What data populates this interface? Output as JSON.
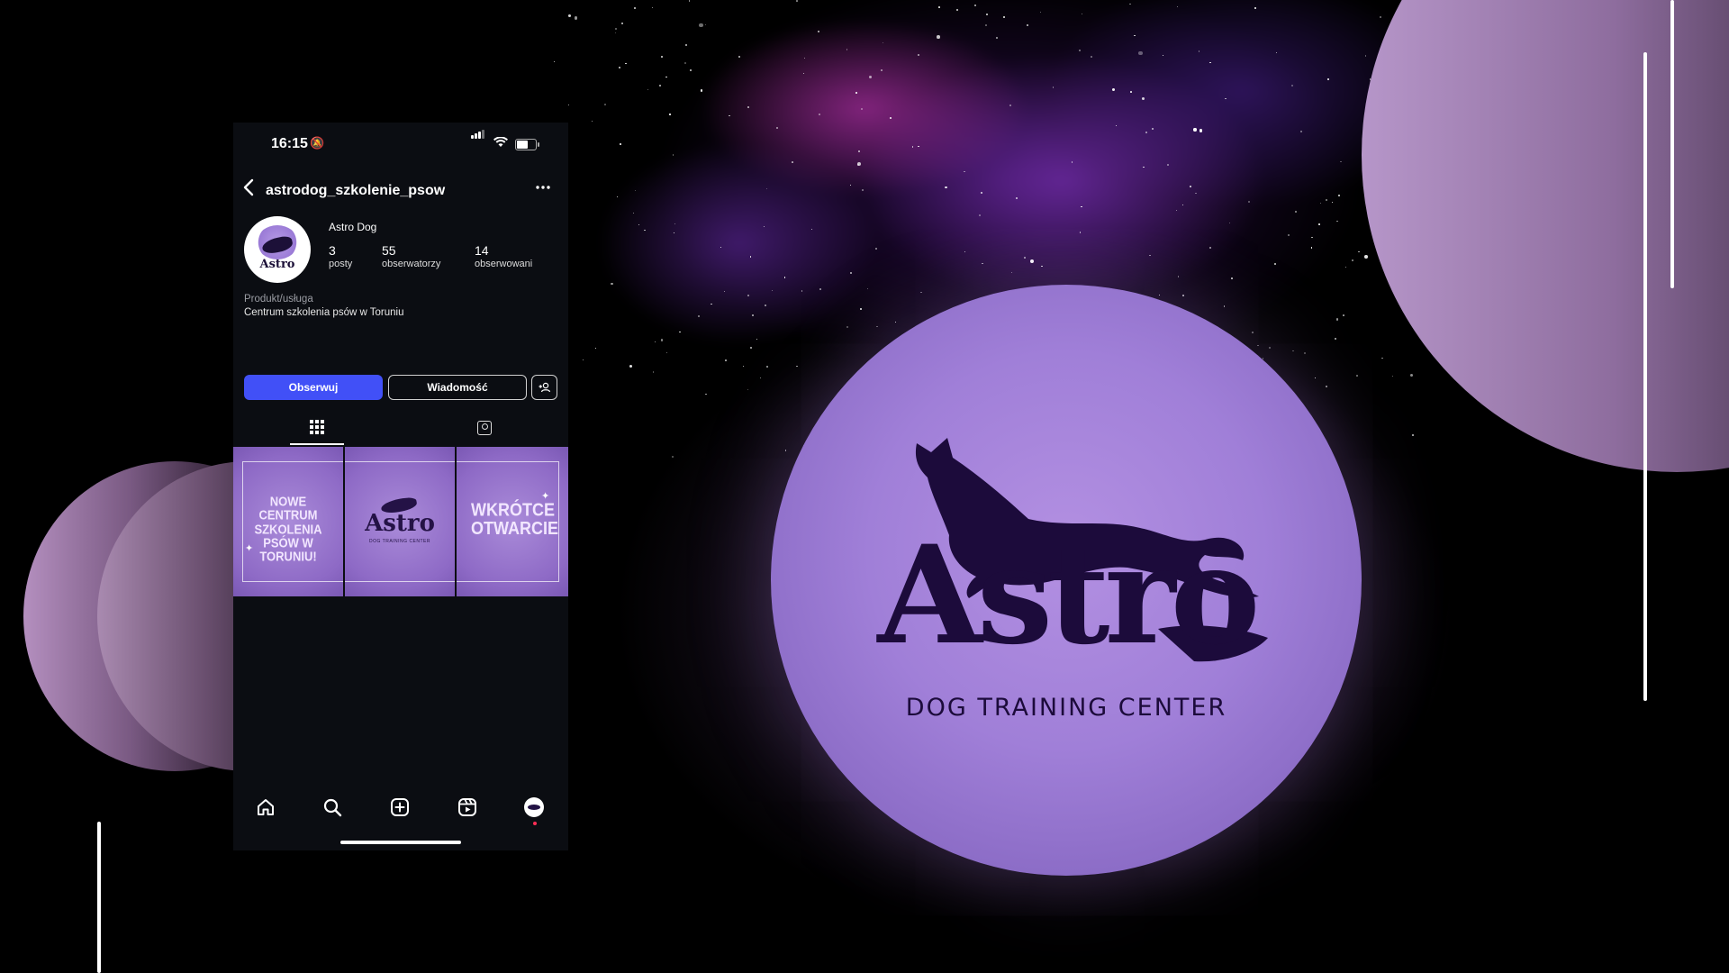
{
  "status_bar": {
    "time": "16:15"
  },
  "profile": {
    "username": "astrodog_szkolenie_psow",
    "display_name": "Astro Dog",
    "avatar_text": "Astro",
    "stats": [
      {
        "count": "3",
        "label": "posty"
      },
      {
        "count": "55",
        "label": "obserwatorzy"
      },
      {
        "count": "14",
        "label": "obserwowani"
      }
    ],
    "category": "Produkt/usługa",
    "bio": "Centrum szkolenia psów w Toruniu"
  },
  "actions": {
    "follow_label": "Obserwuj",
    "message_label": "Wiadomość",
    "follow_color": "#4150f7"
  },
  "posts": [
    {
      "text": "NOWE CENTRUM SZKOLENIA PSÓW W TORUNIU!"
    },
    {
      "logo_text": "Astro",
      "logo_sub": "DOG TRAINING CENTER"
    },
    {
      "text": "WKRÓTCE OTWARCIE"
    }
  ],
  "nav": {
    "items": [
      "home-icon",
      "search-icon",
      "create-icon",
      "reels-icon",
      "profile-icon"
    ]
  },
  "brand": {
    "logo_word": "Astro",
    "logo_sub": "DOG TRAINING CENTER",
    "logo_color": "#1c0b3b",
    "sphere_color": "#a07fd8"
  }
}
